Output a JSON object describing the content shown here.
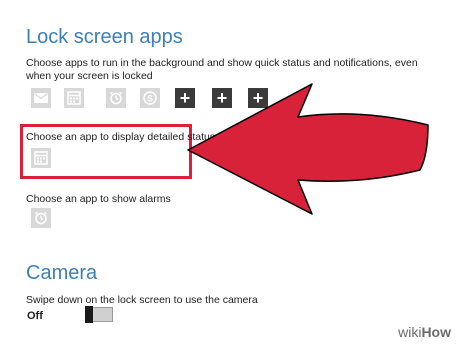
{
  "colors": {
    "accent_title": "#3d7fb7",
    "arrow": "#d8223a",
    "highlight_border": "#d8223a",
    "tile_bg": "#d8d8d8",
    "add_tile_bg": "#3b3b3b"
  },
  "lock_screen_apps": {
    "title": "Lock screen apps",
    "description": "Choose apps to run in the background and show quick status and notifications, even when your screen is locked",
    "app_tiles": [
      {
        "icon": "mail-icon"
      },
      {
        "icon": "calendar-icon"
      },
      {
        "icon": "alarm-icon"
      },
      {
        "icon": "skype-icon"
      },
      {
        "icon": "plus-icon",
        "label": "+"
      },
      {
        "icon": "plus-icon",
        "label": "+"
      },
      {
        "icon": "plus-icon",
        "label": "+"
      }
    ],
    "detailed_status": {
      "label": "Choose an app to display detailed status",
      "icon": "calendar-icon"
    },
    "alarms": {
      "label": "Choose an app to show alarms",
      "icon": "alarm-icon"
    }
  },
  "camera": {
    "title": "Camera",
    "description": "Swipe down on the lock screen to use the camera",
    "toggle_state": "Off"
  },
  "watermark": {
    "prefix": "wiki",
    "suffix": "How"
  }
}
